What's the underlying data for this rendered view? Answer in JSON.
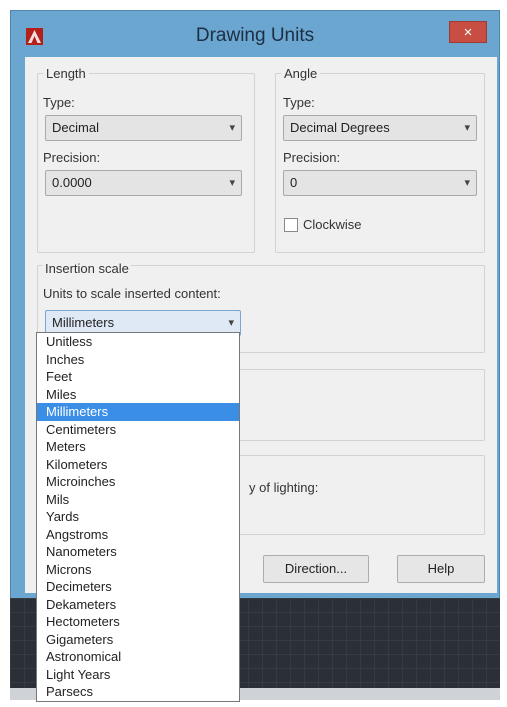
{
  "window": {
    "title": "Drawing Units",
    "close_glyph": "×",
    "app_icon": "autocad-logo-icon",
    "accent": "#c84e43"
  },
  "length": {
    "group_label": "Length",
    "type_label": "Type:",
    "type_value": "Decimal",
    "precision_label": "Precision:",
    "precision_value": "0.0000"
  },
  "angle": {
    "group_label": "Angle",
    "type_label": "Type:",
    "type_value": "Decimal Degrees",
    "precision_label": "Precision:",
    "precision_value": "0",
    "clockwise_label": "Clockwise",
    "clockwise_checked": false
  },
  "insertion": {
    "group_label": "Insertion scale",
    "units_label": "Units to scale inserted content:",
    "selected_value": "Millimeters"
  },
  "lighting": {
    "partial_label": "y of lighting:"
  },
  "buttons": {
    "direction": "Direction...",
    "help": "Help"
  },
  "dropdown": {
    "options": [
      "Unitless",
      "Inches",
      "Feet",
      "Miles",
      "Millimeters",
      "Centimeters",
      "Meters",
      "Kilometers",
      "Microinches",
      "Mils",
      "Yards",
      "Angstroms",
      "Nanometers",
      "Microns",
      "Decimeters",
      "Dekameters",
      "Hectometers",
      "Gigameters",
      "Astronomical",
      "Light Years",
      "Parsecs"
    ],
    "selected_index": 4
  }
}
